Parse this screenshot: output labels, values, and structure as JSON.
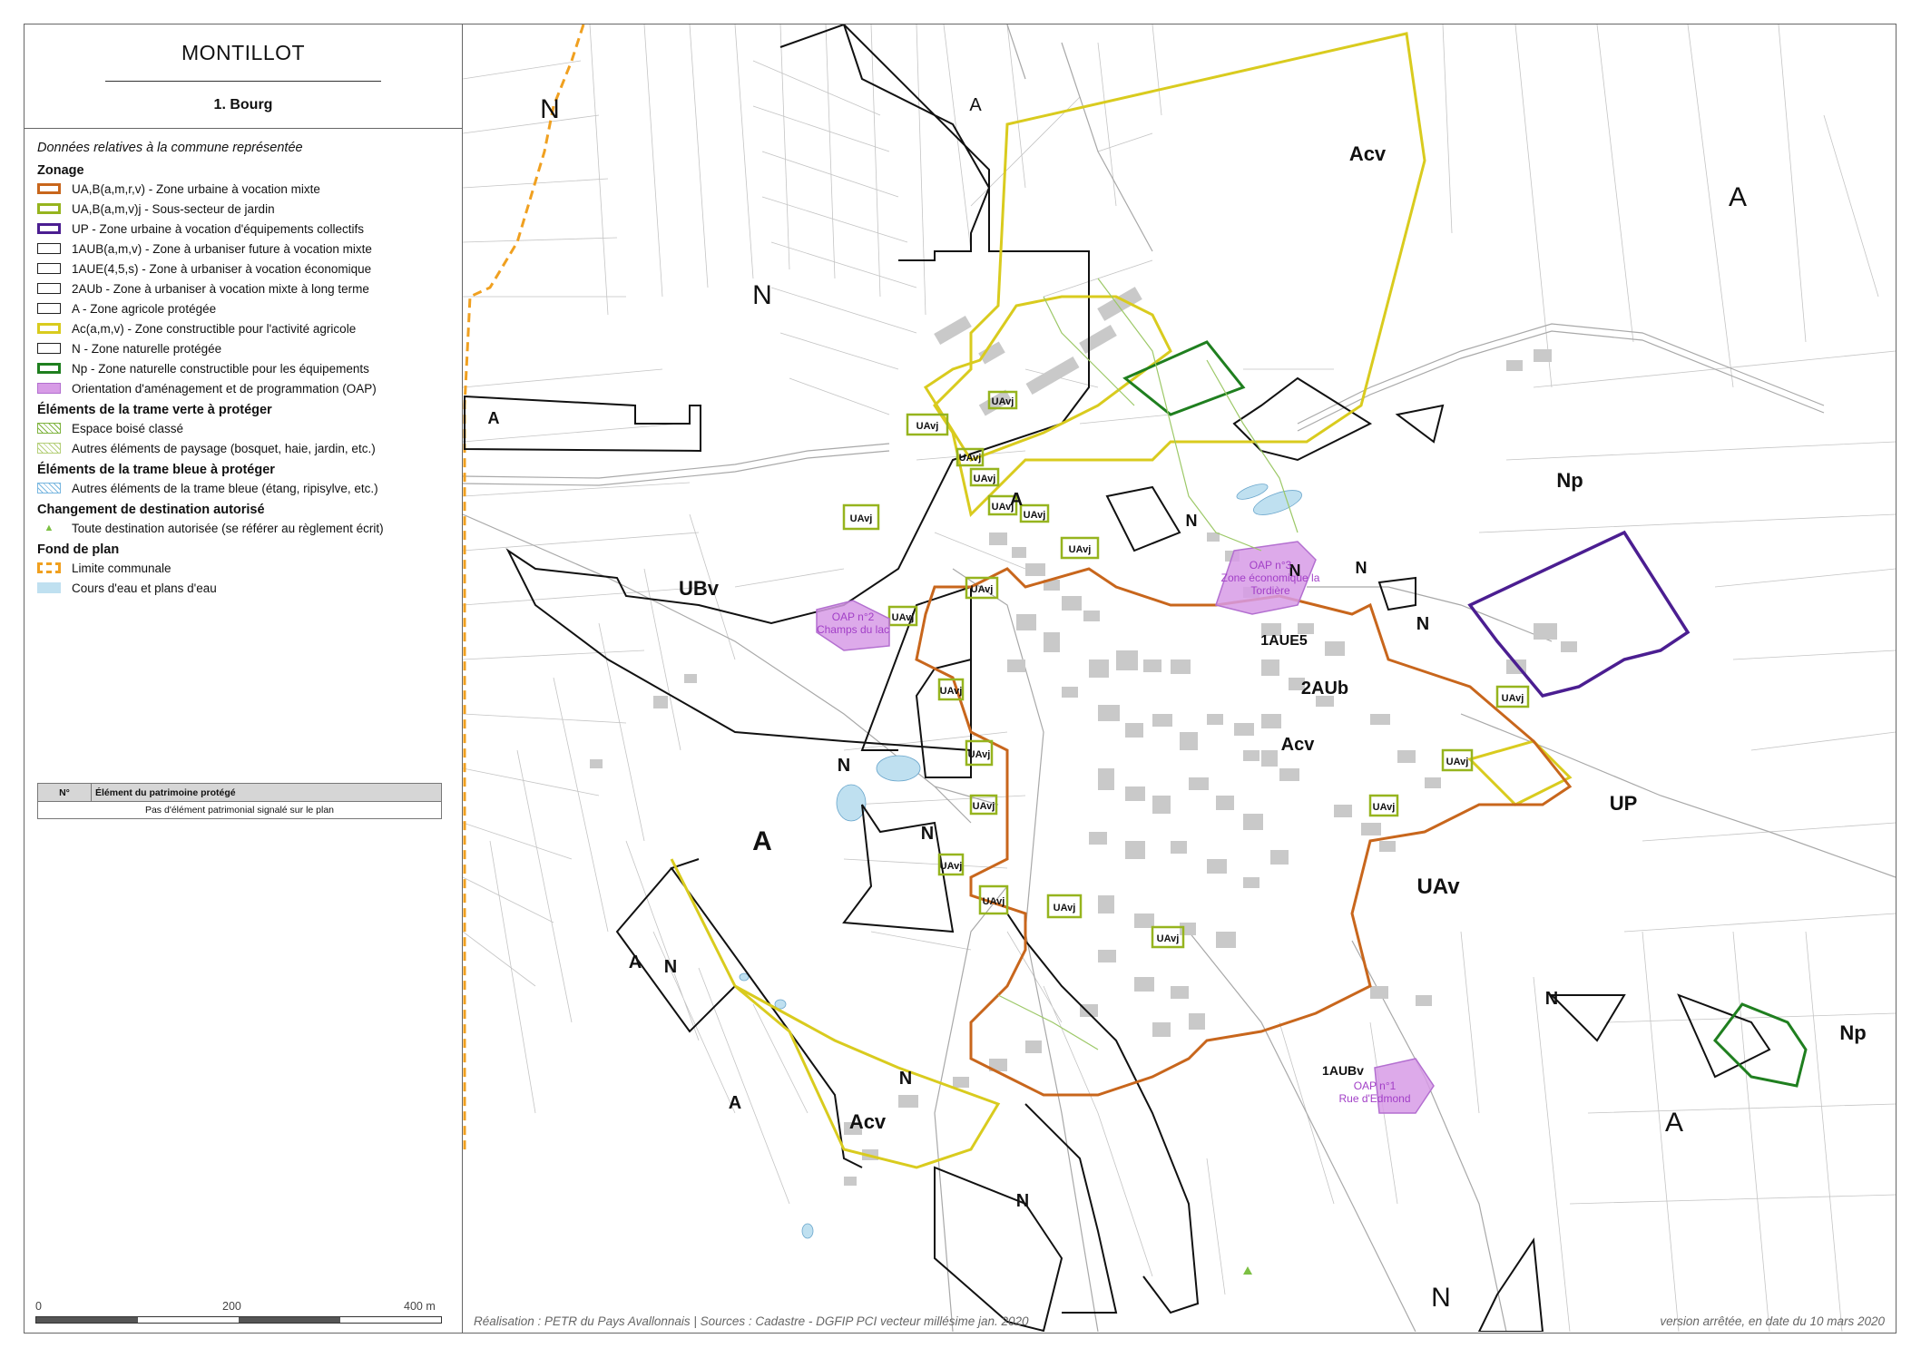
{
  "title": {
    "commune": "MONTILLOT",
    "sector": "1. Bourg"
  },
  "legend": {
    "intro": "Données relatives à la commune représentée",
    "zonage": {
      "heading": "Zonage",
      "items": [
        {
          "label": "UA,B(a,m,r,v) - Zone urbaine à vocation mixte",
          "color": "#c8661c"
        },
        {
          "label": "UA,B(a,m,v)j - Sous-secteur de jardin",
          "color": "#96b41e"
        },
        {
          "label": "UP - Zone urbaine à vocation d'équipements collectifs",
          "color": "#4b1e91"
        },
        {
          "label": "1AUB(a,m,v) - Zone à urbaniser future à vocation mixte",
          "color": "#222222"
        },
        {
          "label": "1AUE(4,5,s) - Zone à urbaniser à vocation économique",
          "color": "#222222"
        },
        {
          "label": "2AUb - Zone à urbaniser à vocation mixte à long terme",
          "color": "#222222"
        },
        {
          "label": "A - Zone agricole protégée",
          "color": "#222222"
        },
        {
          "label": "Ac(a,m,v) - Zone constructible pour l'activité agricole",
          "color": "#d9cb1e"
        },
        {
          "label": "N - Zone naturelle protégée",
          "color": "#222222"
        },
        {
          "label": "Np - Zone naturelle constructible pour les équipements",
          "color": "#1f7f1f"
        },
        {
          "label": "Orientation d'aménagement et de programmation (OAP)",
          "color": "#d79be6"
        }
      ]
    },
    "trame_verte": {
      "heading": "Éléments de la trame verte à protéger",
      "items": [
        {
          "label": "Espace boisé classé"
        },
        {
          "label": "Autres éléments de paysage (bosquet, haie, jardin, etc.)"
        }
      ]
    },
    "trame_bleue": {
      "heading": "Éléments de la trame bleue à protéger",
      "items": [
        {
          "label": "Autres éléments de la trame bleue (étang, ripisylve, etc.)"
        }
      ]
    },
    "changement": {
      "heading": "Changement de destination autorisé",
      "items": [
        {
          "label": "Toute destination autorisée (se référer au règlement écrit)",
          "symbol": "▲"
        }
      ]
    },
    "fond": {
      "heading": "Fond de plan",
      "items": [
        {
          "label": "Limite communale"
        },
        {
          "label": "Cours d'eau et plans d'eau"
        }
      ]
    }
  },
  "patrimoine_table": {
    "headers": [
      "N°",
      "Élément du patrimoine protégé"
    ],
    "row": "Pas d'élément patrimonial signalé sur le plan"
  },
  "scale": {
    "labels": [
      "0",
      "200",
      "400 m"
    ]
  },
  "map_labels": {
    "N": "N",
    "A": "A",
    "Acv": "Acv",
    "Np": "Np",
    "UBv": "UBv",
    "UAv": "UAv",
    "UAvj": "UAvj",
    "UP": "UP",
    "AUE5": "1AUE5",
    "AUb2": "2AUb",
    "AUBv1": "1AUBv",
    "oap1": "OAP n°1",
    "oap1_sub": "Rue d'Edmond",
    "oap2": "OAP n°2",
    "oap2_sub": "Champs du lac",
    "oap3": "OAP n°3",
    "oap3_sub": "Zone économique la",
    "oap3_sub2": "Tordière"
  },
  "credits": "Réalisation : PETR du Pays Avallonnais | Sources : Cadastre - DGFIP PCI vecteur millésime jan. 2020",
  "version": "version arrêtée, en date du 10 mars 2020"
}
